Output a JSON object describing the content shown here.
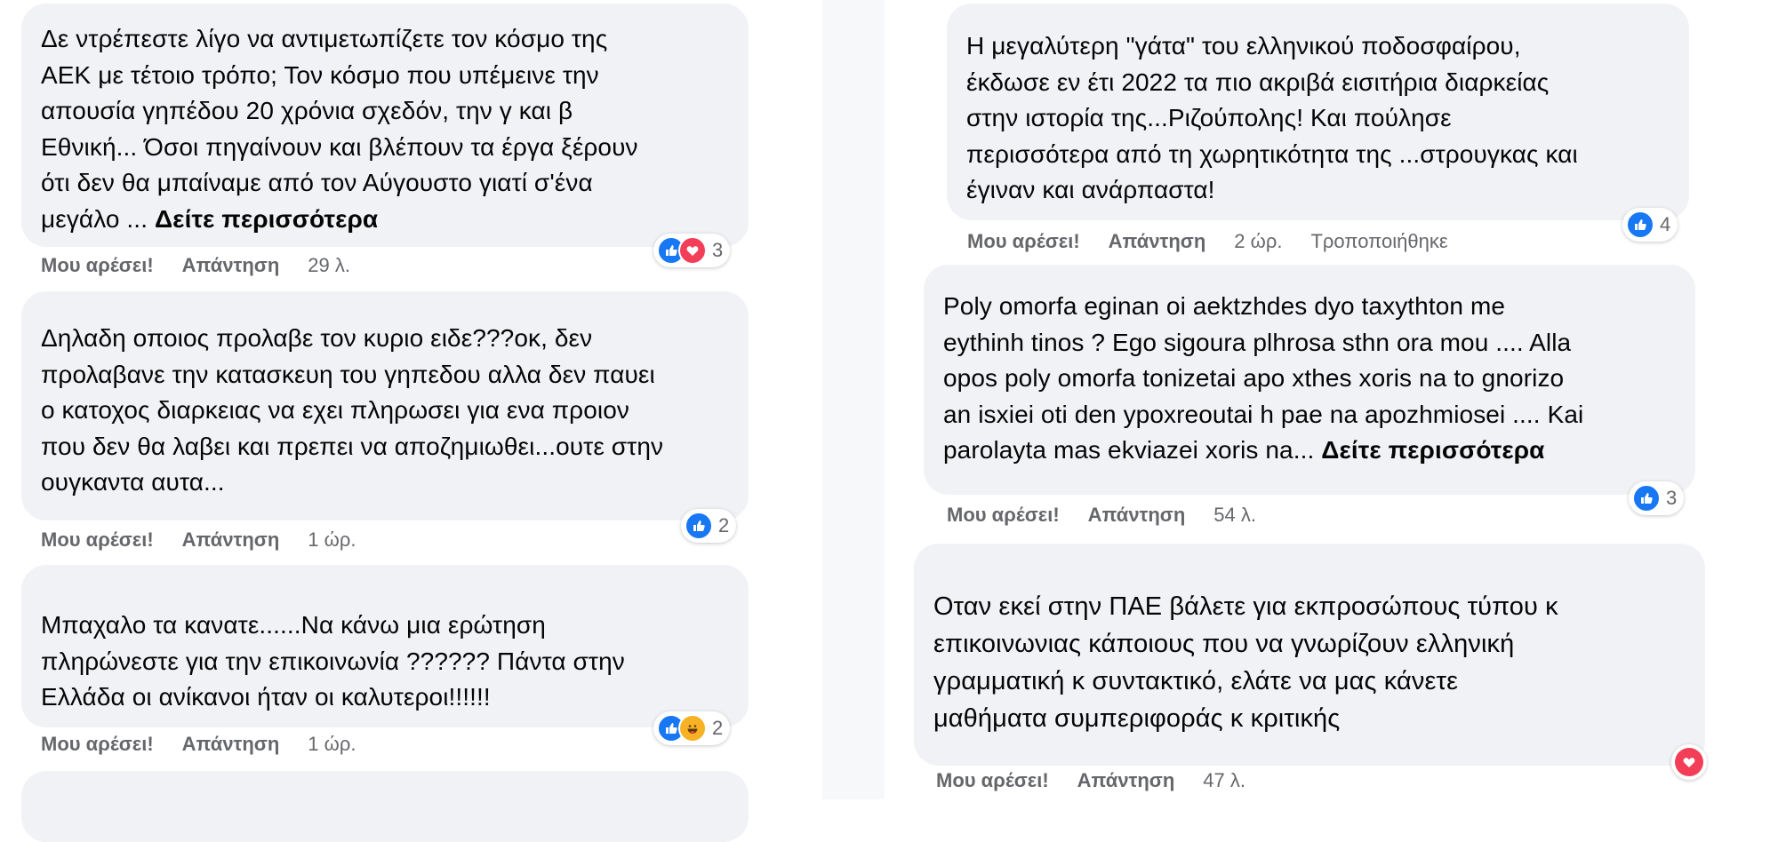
{
  "actions": {
    "like": "Μου αρέσει!",
    "reply": "Απάντηση",
    "edited": "Τροποποιήθηκε"
  },
  "left_comments": [
    {
      "text": "Δε ντρέπεστε λίγο να αντιμετωπίζετε τον κόσμο της\nΑΕΚ με τέτοιο τρόπο; Τον κόσμο που υπέμεινε την\nαπουσία γηπέδου 20 χρόνια σχεδόν, την γ και β\nΕθνική... Όσοι πηγαίνουν και βλέπουν τα έργα ξέρουν\nότι δεν θα μπαίναμε από τον Αύγουστο γιατί σ'ένα\nμεγάλο ... ",
      "see_more": "Δείτε περισσότερα",
      "time": "29 λ.",
      "reactions": [
        "like",
        "love"
      ],
      "count": "3"
    },
    {
      "text": "Δηλαδη οποιος προλαβε τον κυριο ειδε???οκ, δεν\nπρολαβανε την κατασκευη του γηπεδου αλλα δεν παυει\nο κατοχος διαρκειας να εχει πληρωσει για ενα προιον\nπου δεν θα λαβει και πρεπει να αποζημιωθει...ουτε στην\nουγκαντα αυτα...",
      "time": "1 ώρ.",
      "reactions": [
        "like"
      ],
      "count": "2"
    },
    {
      "text": "Μπαχαλο τα κανατε......Να κάνω μια ερώτηση\nπληρώνεστε για την επικοινωνία ?????? Πάντα στην\nΕλλάδα οι ανίκανοι ήταν οι καλυτεροι!!!!!!",
      "time": "1 ώρ.",
      "reactions": [
        "like",
        "haha"
      ],
      "count": "2"
    }
  ],
  "right_comments": [
    {
      "text": "Η μεγαλύτερη \"γάτα\" του ελληνικού ποδοσφαίρου,\nέκδωσε εν έτι 2022 τα πιο ακριβά εισιτήρια διαρκείας\nστην ιστορία της...Ριζούπολης! Και πούλησε\nπερισσότερα από τη χωρητικότητα της ...στρουγκας και\nέγιναν και ανάρπαστα!",
      "time": "2 ώρ.",
      "reactions": [
        "like"
      ],
      "count": "4"
    },
    {
      "text": "Poly omorfa eginan oi aektzhdes dyo taxythton me\neythinh tinos ? Ego sigoura plhrosa sthn ora mou .... Alla\nopos poly omorfa tonizetai apo xthes xoris na to gnorizo\nan isxiei oti den ypoxreoutai h pae na apozhmiosei .... Kai\nparolayta mas ekviazei xoris na... ",
      "see_more": "Δείτε περισσότερα",
      "time": "54 λ.",
      "reactions": [
        "like"
      ],
      "count": "3"
    },
    {
      "text": "Οταν εκεί στην ΠΑΕ βάλετε για εκπροσώπους τύπου κ\nεπικοινωνιας κάποιους που να γνωρίζουν ελληνική\nγραμματική κ συντακτικό, ελάτε να μας κάνετε\nμαθήματα συμπεριφοράς κ κριτικής",
      "time": "47 λ.",
      "reactions": [
        "love"
      ]
    }
  ]
}
